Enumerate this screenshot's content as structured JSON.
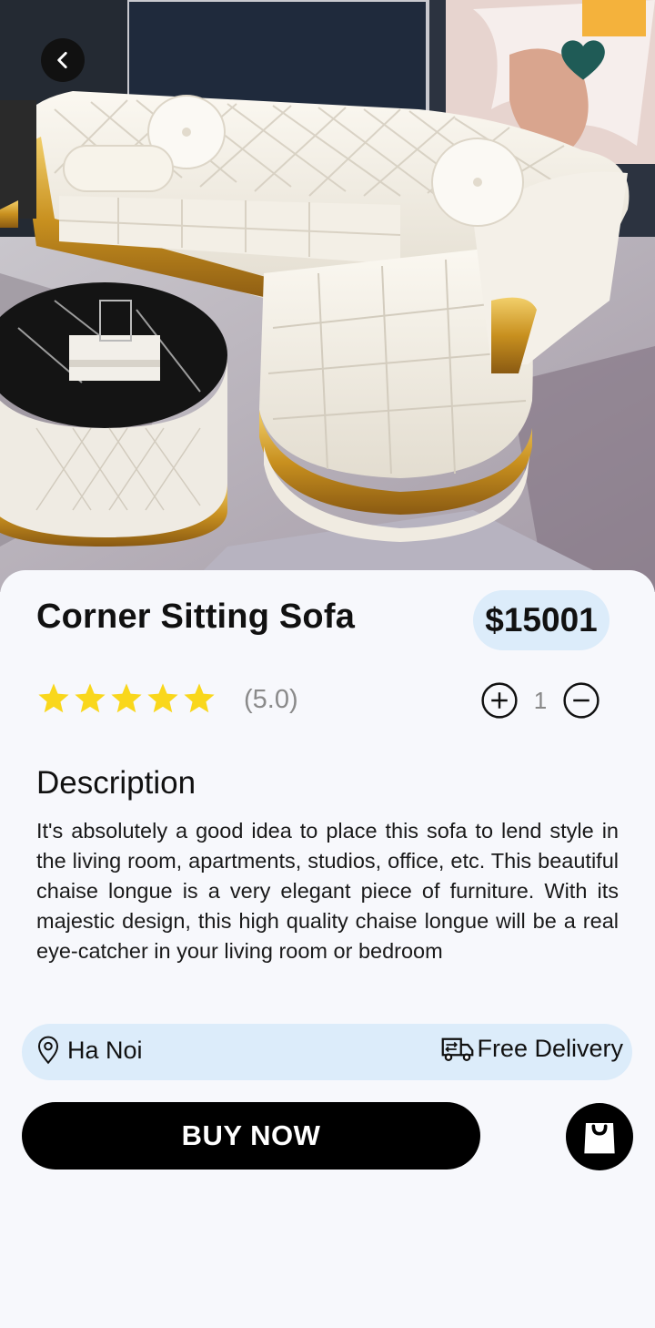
{
  "product": {
    "name": "Corner Sitting Sofa",
    "price": "$15001",
    "rating_value": 5,
    "rating_text": "(5.0)",
    "quantity": "1"
  },
  "description": {
    "heading": "Description",
    "body": "It's absolutely a good idea to place this sofa to lend style in the living room, apartments, studios, office, etc. This beautiful chaise longue is a very elegant piece of furniture. With its majestic design, this high quality chaise longue will be a real eye-catcher in your living room or bedroom"
  },
  "info": {
    "location": "Ha Noi",
    "delivery": "Free Delivery"
  },
  "actions": {
    "buy_label": "BUY NOW"
  },
  "icons": {
    "back": "chevron-left-icon",
    "favorite": "heart-icon",
    "star": "star-icon",
    "plus": "plus-circle-icon",
    "minus": "minus-circle-icon",
    "location": "map-pin-icon",
    "delivery": "truck-icon",
    "cart": "shopping-bag-icon"
  },
  "colors": {
    "accent": "#dcecfa",
    "star": "#f9d71c",
    "favorite": "#1f5b56",
    "button": "#000000"
  }
}
